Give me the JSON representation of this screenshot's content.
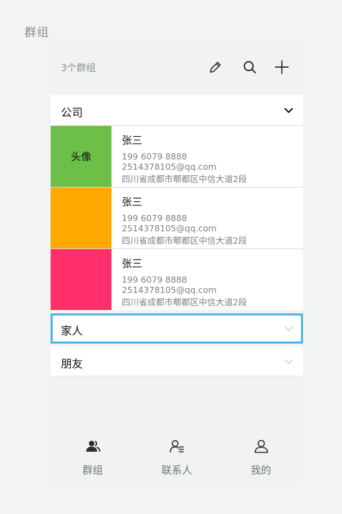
{
  "page_label": "群组",
  "header": {
    "title": "3个群组",
    "actions": [
      {
        "icon": "pencil-icon",
        "name": "edit-button"
      },
      {
        "icon": "search-icon",
        "name": "search-button"
      },
      {
        "icon": "plus-icon",
        "name": "add-button"
      }
    ]
  },
  "groups": [
    {
      "title": "公司",
      "expanded": true,
      "contacts": [
        {
          "avatar_text": "头像",
          "avatar_color": "#6cc04a",
          "name": "张三",
          "phone": "199 6079 8888",
          "email": "2514378105@qq.com",
          "address": "四川省成都市郫都区中信大道2段"
        },
        {
          "avatar_text": "",
          "avatar_color": "#ffa800",
          "name": "张三",
          "phone": "199 6079 8888",
          "email": "2514378105@qq.com",
          "address": "四川省成都市郫都区中信大道2段"
        },
        {
          "avatar_text": "",
          "avatar_color": "#ff2f6c",
          "name": "张三",
          "phone": "199 6079 8888",
          "email": "2514378105@qq.com",
          "address": "四川省成都市郫都区中信大道2段"
        }
      ]
    },
    {
      "title": "家人",
      "expanded": false,
      "selected": true
    },
    {
      "title": "朋友",
      "expanded": false
    }
  ],
  "tabbar": {
    "tabs": [
      {
        "label": "群组",
        "icon": "group-icon"
      },
      {
        "label": "联系人",
        "icon": "contacts-icon"
      },
      {
        "label": "我的",
        "icon": "profile-icon"
      }
    ]
  },
  "colors": {
    "selected_border": "#4db2e6",
    "background": "#f1f2f2"
  }
}
